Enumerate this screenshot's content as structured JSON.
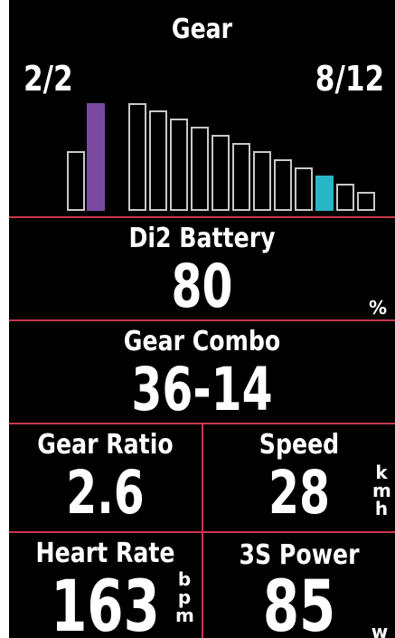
{
  "gear": {
    "title": "Gear",
    "front_position": "2/2",
    "rear_position": "8/12",
    "front_active_color": "#7a4aa0",
    "rear_active_color": "#29b6c6"
  },
  "battery": {
    "title": "Di2 Battery",
    "value": "80",
    "unit": "%"
  },
  "gear_combo": {
    "title": "Gear Combo",
    "value": "36-14"
  },
  "gear_ratio": {
    "title": "Gear Ratio",
    "value": "2.6"
  },
  "speed": {
    "title": "Speed",
    "value": "28",
    "unit": "k\nm\nh"
  },
  "heart_rate": {
    "title": "Heart Rate",
    "value": "163",
    "unit": "b\np\nm"
  },
  "power": {
    "title": "3S Power",
    "value": "85",
    "unit": "w"
  },
  "accent_color": "#c8384d"
}
